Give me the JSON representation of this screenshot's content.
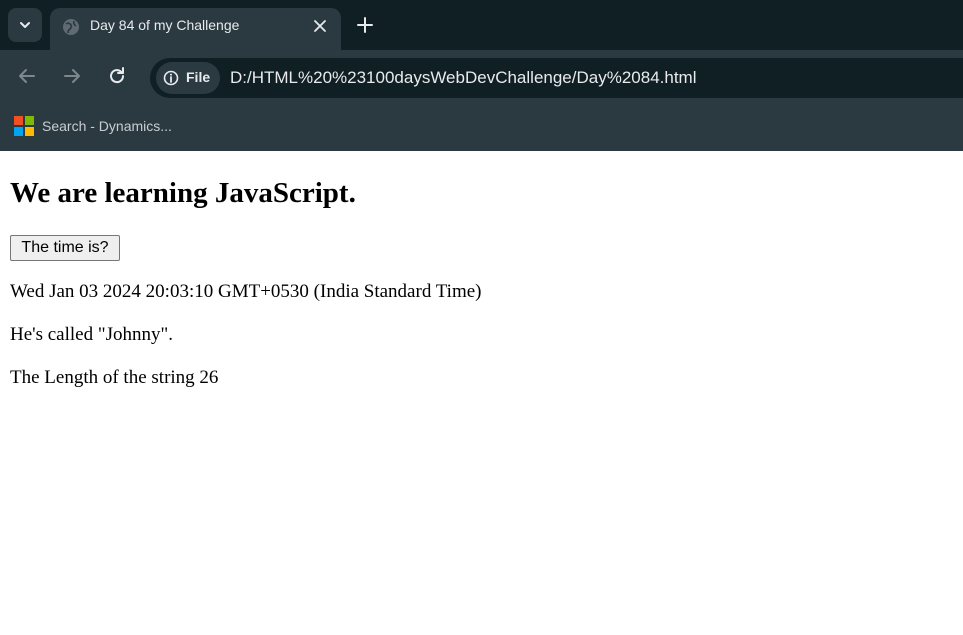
{
  "browser": {
    "tab": {
      "title": "Day 84 of my Challenge",
      "favicon": "globe-icon"
    },
    "toolbar": {
      "scheme_chip_label": "File",
      "url": "D:/HTML%20%23100daysWebDevChallenge/Day%2084.html"
    },
    "bookmarks": [
      {
        "label": "Search - Dynamics...",
        "icon": "microsoft-logo"
      }
    ],
    "colors": {
      "frame": "#0f1f24",
      "toolbar": "#2b3a40",
      "text": "#e8eaed"
    }
  },
  "page": {
    "heading": "We are learning JavaScript.",
    "button_label": "The time is?",
    "date_text": "Wed Jan 03 2024 20:03:10 GMT+0530 (India Standard Time)",
    "quote_text": "He's called \"Johnny\".",
    "length_text": "The Length of the string 26"
  }
}
